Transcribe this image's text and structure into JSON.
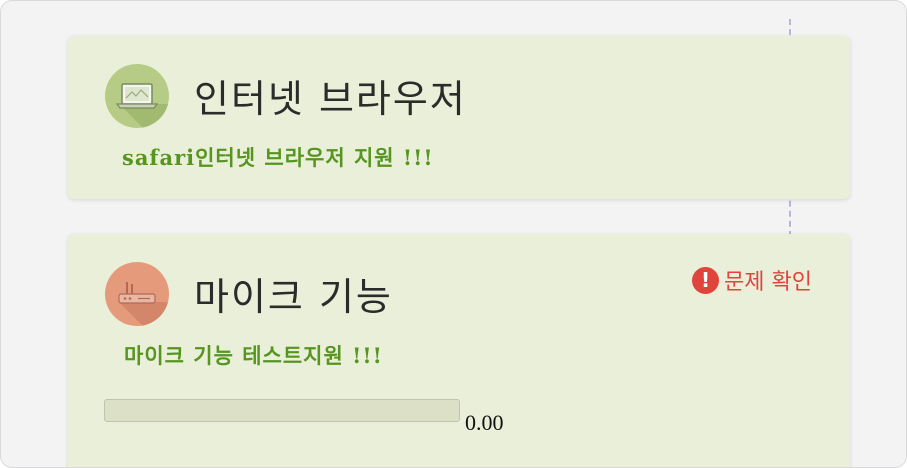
{
  "cards": {
    "browser": {
      "title": "인터넷 브라우저",
      "subtitle": "safari인터넷 브라우저 지원 !!!",
      "icon": "laptop-icon",
      "icon_color": "#b6cc86"
    },
    "microphone": {
      "title": "마이크 기능",
      "subtitle": "마이크 기능 테스트지원 !!!",
      "icon": "router-icon",
      "icon_color": "#e59a7c",
      "issue_label": "문제 확인",
      "issue_icon": "exclamation-icon",
      "issue_color": "#e0453d",
      "level": 0,
      "level_text": "0.00"
    }
  },
  "colors": {
    "card_bg": "#e9efd8",
    "subtitle": "#56951f"
  }
}
